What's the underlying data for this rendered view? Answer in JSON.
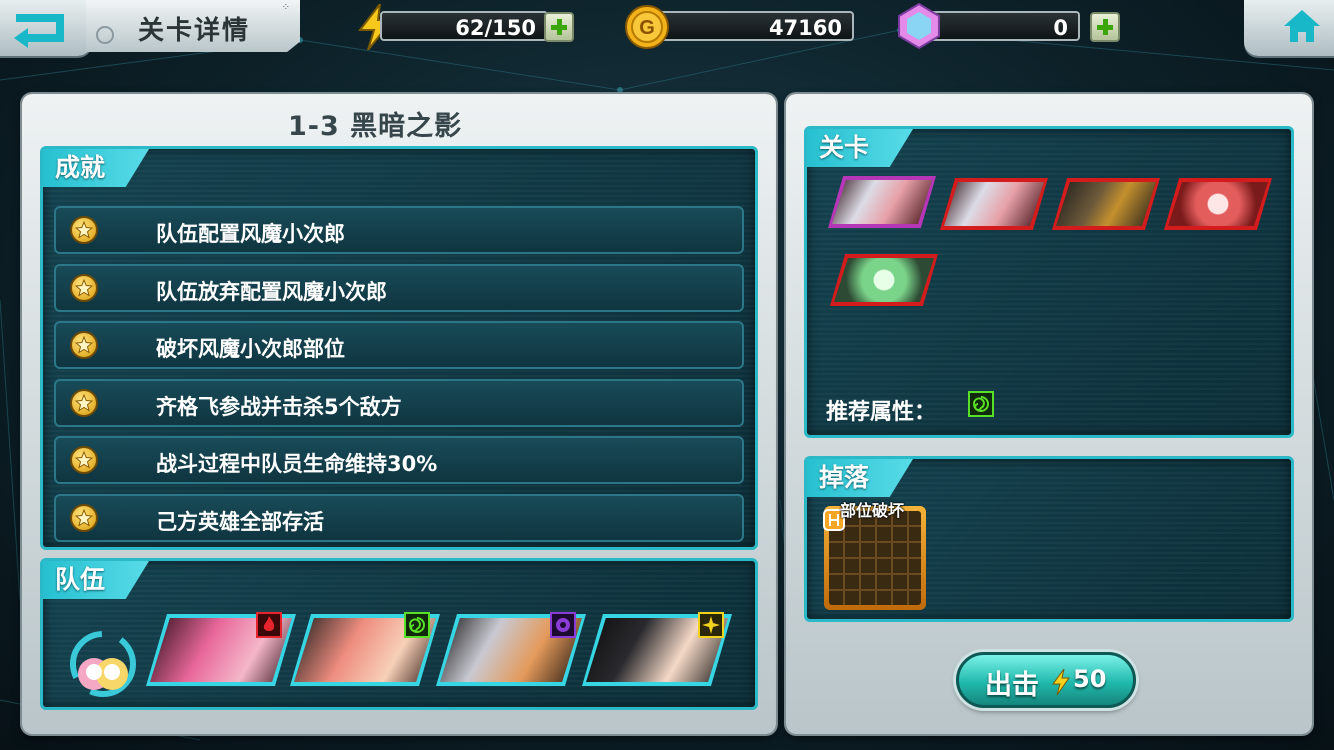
{
  "header": {
    "page_title": "关卡详情",
    "stamina": "62/150",
    "gold": "47160",
    "gems": "0"
  },
  "stage": {
    "title": "1-3  黑暗之影"
  },
  "achievements": {
    "label": "成就",
    "items": [
      "队伍配置风魔小次郎",
      "队伍放弃配置风魔小次郎",
      "破坏风魔小次郎部位",
      "齐格飞参战并击杀5个敌方",
      "战斗过程中队员生命维持30%",
      "己方英雄全部存活"
    ]
  },
  "team": {
    "label": "队伍",
    "members": [
      {
        "element": "fire",
        "color": "#e6242b"
      },
      {
        "element": "wind",
        "color": "#5adf28"
      },
      {
        "element": "dark",
        "color": "#8b3bd6"
      },
      {
        "element": "light",
        "color": "#f2d21a"
      }
    ]
  },
  "level_panel": {
    "label": "关卡",
    "recommend_label": "推荐属性：",
    "recommend_element": "wind"
  },
  "drops": {
    "label": "掉落",
    "item_label": "部位破坏"
  },
  "action": {
    "fight_label": "出击",
    "fight_cost": "50"
  },
  "colors": {
    "accent": "#2bb8c7",
    "panel_bg": "#0c2e38",
    "button": "#21b9ad"
  }
}
